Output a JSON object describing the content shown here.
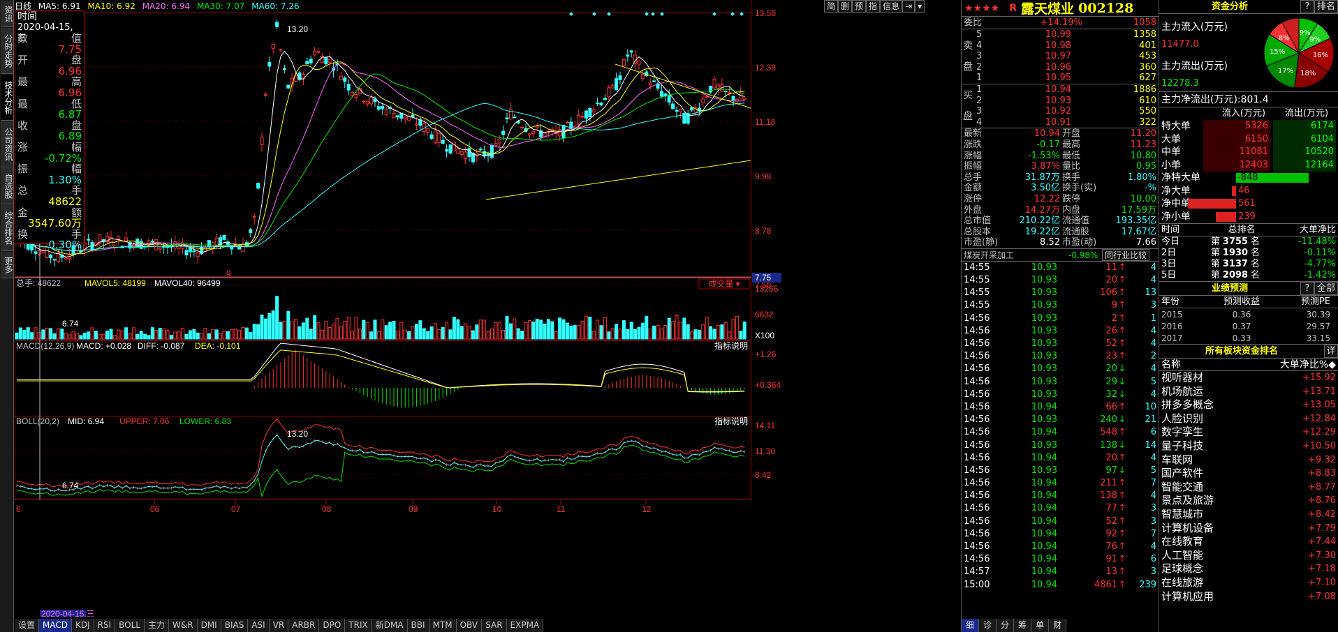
{
  "left_tabs": [
    "资讯",
    "分时走势",
    "技术分析",
    "公司资讯",
    "自选股",
    "综合排名",
    "更多"
  ],
  "ma_bar": {
    "period": "日线",
    "ma5": "MA5: 6.91",
    "ma10": "MA10: 6.92",
    "ma20": "MA20: 6.94",
    "ma30": "MA30: 7.07",
    "ma60": "MA60: 7.26"
  },
  "toolbar_buttons": [
    "简",
    "删",
    "预",
    "指",
    "信息",
    "⇥",
    "▾"
  ],
  "infobox": {
    "title": "时间",
    "date": "2020-04-15,三",
    "rows": [
      {
        "l": "数",
        "r": "值",
        "c": "gry"
      },
      {
        "l": "",
        "r": "7.75",
        "c": "red"
      },
      {
        "l": "开",
        "r": "盘",
        "c": "gry"
      },
      {
        "l": "",
        "r": "6.96",
        "c": "red"
      },
      {
        "l": "最",
        "r": "高",
        "c": "gry"
      },
      {
        "l": "",
        "r": "6.96",
        "c": "red"
      },
      {
        "l": "最",
        "r": "低",
        "c": "gry"
      },
      {
        "l": "",
        "r": "6.87",
        "c": "grn"
      },
      {
        "l": "收",
        "r": "盘",
        "c": "gry"
      },
      {
        "l": "",
        "r": "6.89",
        "c": "grn"
      },
      {
        "l": "涨",
        "r": "幅",
        "c": "gry"
      },
      {
        "l": "",
        "r": "-0.72%",
        "c": "grn"
      },
      {
        "l": "振",
        "r": "幅",
        "c": "gry"
      },
      {
        "l": "",
        "r": "1.30%",
        "c": "cyan"
      },
      {
        "l": "总",
        "r": "手",
        "c": "gry"
      },
      {
        "l": "",
        "r": "48622",
        "c": "yel"
      },
      {
        "l": "金",
        "r": "额",
        "c": "gry"
      },
      {
        "l": "",
        "r": "3547.60万",
        "c": "yel"
      },
      {
        "l": "换",
        "r": "手",
        "c": "gry"
      },
      {
        "l": "",
        "r": "0.30%",
        "c": "cyan"
      }
    ]
  },
  "price_axis": [
    "13.56",
    "12.38",
    "11.18",
    "9.98",
    "8.78",
    "7.58"
  ],
  "price_current": "7.75",
  "peak_label": "13.20",
  "low_label": "6.74",
  "vol_bar": {
    "total": "总手: 48622",
    "mavol5": "MAVOL5: 48199",
    "mavol40": "MAVOL40: 96499",
    "select": "成交量 ▾"
  },
  "vol_axis": [
    "13265",
    "6632",
    "X100"
  ],
  "macd_bar": {
    "name": "MACD(12,26,9)",
    "macd": "MACD: +0.028",
    "diff": "DIFF: -0.087",
    "dea": "DEA: -0.101",
    "help": "指标说明"
  },
  "macd_axis": [
    "+1.26",
    "+0.364"
  ],
  "boll_bar": {
    "name": "BOLL(20,2)",
    "mid": "MID: 6.94",
    "upper": "UPPER: 7.06",
    "lower": "LOWER: 6.83",
    "help": "指标说明"
  },
  "boll_axis": [
    "14.11",
    "11.30",
    "8.42"
  ],
  "boll_peak": "13.20",
  "boll_low": "6.74",
  "x_axis": [
    "6",
    "06",
    "07",
    "08",
    "09",
    "10",
    "11",
    "12"
  ],
  "cursor_date": "2020-04-15,三",
  "bottom_tabs": [
    "设置",
    "MACD",
    "KDJ",
    "RSI",
    "BOLL",
    "主力",
    "W&R",
    "DMI",
    "BIAS",
    "ASI",
    "VR",
    "ARBR",
    "DPO",
    "TRIX",
    "新DMA",
    "BBI",
    "MTM",
    "OBV",
    "SAR",
    "EXPMA"
  ],
  "stock": {
    "stars": "★★★★",
    "tag": "R",
    "name": "露天煤业",
    "code": "002128"
  },
  "weibi": {
    "label": "委比",
    "pct": "+14.19%",
    "val": "1058"
  },
  "sell": [
    {
      "n": "5",
      "p": "10.99",
      "v": "1358"
    },
    {
      "n": "4",
      "p": "10.98",
      "v": "401"
    },
    {
      "n": "3",
      "p": "10.97",
      "v": "453"
    },
    {
      "n": "2",
      "p": "10.96",
      "v": "360"
    },
    {
      "n": "1",
      "p": "10.95",
      "v": "627"
    }
  ],
  "buy": [
    {
      "n": "1",
      "p": "10.94",
      "v": "1886"
    },
    {
      "n": "2",
      "p": "10.93",
      "v": "610"
    },
    {
      "n": "3",
      "p": "10.92",
      "v": "550"
    },
    {
      "n": "4",
      "p": "10.91",
      "v": "322"
    }
  ],
  "sell_label": [
    "卖",
    "盘"
  ],
  "buy_label": [
    "买",
    "盘"
  ],
  "stats": [
    [
      "最新",
      "10.94",
      "r",
      "开盘",
      "11.20",
      "r"
    ],
    [
      "涨跌",
      "-0.17",
      "g",
      "最高",
      "11.23",
      "r"
    ],
    [
      "涨幅",
      "-1.53%",
      "g",
      "最低",
      "10.80",
      "g"
    ],
    [
      "振幅",
      "3.87%",
      "r",
      "量比",
      "0.95",
      "g"
    ],
    [
      "总手",
      "31.87万",
      "c",
      "换手",
      "1.80%",
      "c"
    ],
    [
      "金额",
      "3.50亿",
      "c",
      "换手(实)",
      "-%",
      "c"
    ],
    [
      "涨停",
      "12.22",
      "r",
      "跌停",
      "10.00",
      "g"
    ],
    [
      "外盘",
      "14.27万",
      "r",
      "内盘",
      "17.59万",
      "g"
    ],
    [
      "总市值",
      "210.22亿",
      "c",
      "流通值",
      "193.35亿",
      "c"
    ],
    [
      "总股本",
      "19.22亿",
      "c",
      "流通股",
      "17.67亿",
      "c"
    ],
    [
      "市盈(静)",
      "8.52",
      "w",
      "市盈(动)",
      "7.66",
      "w"
    ]
  ],
  "industry": {
    "name": "煤炭开采加工",
    "pct": "-0.98%",
    "btn": "同行业比较"
  },
  "ticks": [
    [
      "14:55",
      "10.93",
      "11",
      "↑",
      "4"
    ],
    [
      "14:55",
      "10.93",
      "20",
      "↑",
      "4"
    ],
    [
      "14:55",
      "10.93",
      "106",
      "↑",
      "13"
    ],
    [
      "14:55",
      "10.93",
      "9",
      "↑",
      "3"
    ],
    [
      "14:56",
      "10.93",
      "2",
      "↑",
      "1"
    ],
    [
      "14:56",
      "10.93",
      "26",
      "↑",
      "4"
    ],
    [
      "14:56",
      "10.93",
      "52",
      "↑",
      "4"
    ],
    [
      "14:56",
      "10.93",
      "23",
      "↑",
      "2"
    ],
    [
      "14:56",
      "10.93",
      "20",
      "↓",
      "4"
    ],
    [
      "14:56",
      "10.93",
      "29",
      "↓",
      "5"
    ],
    [
      "14:56",
      "10.93",
      "32",
      "↓",
      "4"
    ],
    [
      "14:56",
      "10.94",
      "66",
      "↑",
      "10"
    ],
    [
      "14:56",
      "10.93",
      "240",
      "↓",
      "21"
    ],
    [
      "14:56",
      "10.94",
      "548",
      "↑",
      "6"
    ],
    [
      "14:56",
      "10.93",
      "138",
      "↓",
      "14"
    ],
    [
      "14:56",
      "10.94",
      "20",
      "↑",
      "4"
    ],
    [
      "14:56",
      "10.93",
      "97",
      "↓",
      "5"
    ],
    [
      "14:56",
      "10.94",
      "211",
      "↑",
      "7"
    ],
    [
      "14:56",
      "10.94",
      "138",
      "↑",
      "4"
    ],
    [
      "14:56",
      "10.94",
      "77",
      "↑",
      "3"
    ],
    [
      "14:56",
      "10.94",
      "52",
      "↑",
      "3"
    ],
    [
      "14:56",
      "10.94",
      "92",
      "↑",
      "7"
    ],
    [
      "14:56",
      "10.94",
      "76",
      "↑",
      "4"
    ],
    [
      "14:56",
      "10.94",
      "91",
      "↑",
      "6"
    ],
    [
      "14:57",
      "10.94",
      "13",
      "↑",
      "3"
    ],
    [
      "15:00",
      "10.94",
      "4861",
      "↑",
      "239"
    ]
  ],
  "quote_tabs": [
    "细",
    "诊",
    "分",
    "筹",
    "单",
    "财"
  ],
  "fund": {
    "title": "资金分析",
    "help": "?",
    "rank": "排名",
    "inflow_label": "主力流入(万元)",
    "inflow": "11477.0",
    "outflow_label": "主力流出(万元)",
    "outflow": "12278.3",
    "net_label": "主力净流出(万元):",
    "net": "801.4",
    "pie": [
      {
        "v": 9,
        "c": "#00c000"
      },
      {
        "v": 9,
        "c": "#20d020"
      },
      {
        "v": 16,
        "c": "#aa0000"
      },
      {
        "v": 18,
        "c": "#880000"
      },
      {
        "v": 17,
        "c": "#008800"
      },
      {
        "v": 15,
        "c": "#00aa00"
      },
      {
        "v": 8,
        "c": "#ff3232"
      },
      {
        "v": 8,
        "c": "#cc2020"
      }
    ],
    "pie_labels": [
      "9%",
      "9%",
      "16%",
      "18%",
      "17%",
      "15%",
      "8%"
    ],
    "flow_hdr": [
      "流入(万元)",
      "流出(万元)"
    ],
    "flows": [
      [
        "特大单",
        "5326",
        "6174"
      ],
      [
        "大单",
        "6150",
        "6104"
      ],
      [
        "中单",
        "11081",
        "10520"
      ],
      [
        "小单",
        "12403",
        "12164"
      ]
    ],
    "nets": [
      [
        "净特大单",
        "-848"
      ],
      [
        "净大单",
        "46"
      ],
      [
        "净中单",
        "561"
      ],
      [
        "净小单",
        "239"
      ]
    ],
    "rank_hdr": [
      "时间",
      "总排名",
      "大单净比"
    ],
    "ranks": [
      [
        "今日",
        "第",
        "3755",
        "名",
        "-11.48%"
      ],
      [
        "2日",
        "第",
        "1930",
        "名",
        "-0.11%"
      ],
      [
        "3日",
        "第",
        "3137",
        "名",
        "-4.77%"
      ],
      [
        "5日",
        "第",
        "2098",
        "名",
        "-1.42%"
      ]
    ],
    "forecast_title": "业绩预测",
    "forecast_btns": [
      "?",
      "全部"
    ],
    "forecast_hdr": [
      "年份",
      "预测收益",
      "预测PE"
    ],
    "forecast": [
      [
        "2015",
        "0.36",
        "30.39"
      ],
      [
        "2016",
        "0.37",
        "29.57"
      ],
      [
        "2017",
        "0.33",
        "33.15"
      ]
    ],
    "sector_title": "所有板块资金排名",
    "sector_btn": "详",
    "sector_hdr": [
      "名称",
      "大单净比%◆"
    ],
    "sectors": [
      [
        "视听器材",
        "+15.92"
      ],
      [
        "机场航运",
        "+13.71"
      ],
      [
        "拼多多概念",
        "+13.05"
      ],
      [
        "人脸识别",
        "+12.84"
      ],
      [
        "数字孪生",
        "+12.29"
      ],
      [
        "量子科技",
        "+10.50"
      ],
      [
        "车联网",
        "+9.32"
      ],
      [
        "国产软件",
        "+8.83"
      ],
      [
        "智能交通",
        "+8.77"
      ],
      [
        "景点及旅游",
        "+8.76"
      ],
      [
        "智慧城市",
        "+8.42"
      ],
      [
        "计算机设备",
        "+7.79"
      ],
      [
        "在线教育",
        "+7.44"
      ],
      [
        "人工智能",
        "+7.30"
      ],
      [
        "足球概念",
        "+7.18"
      ],
      [
        "在线旅游",
        "+7.10"
      ],
      [
        "计算机应用",
        "+7.08"
      ]
    ]
  }
}
